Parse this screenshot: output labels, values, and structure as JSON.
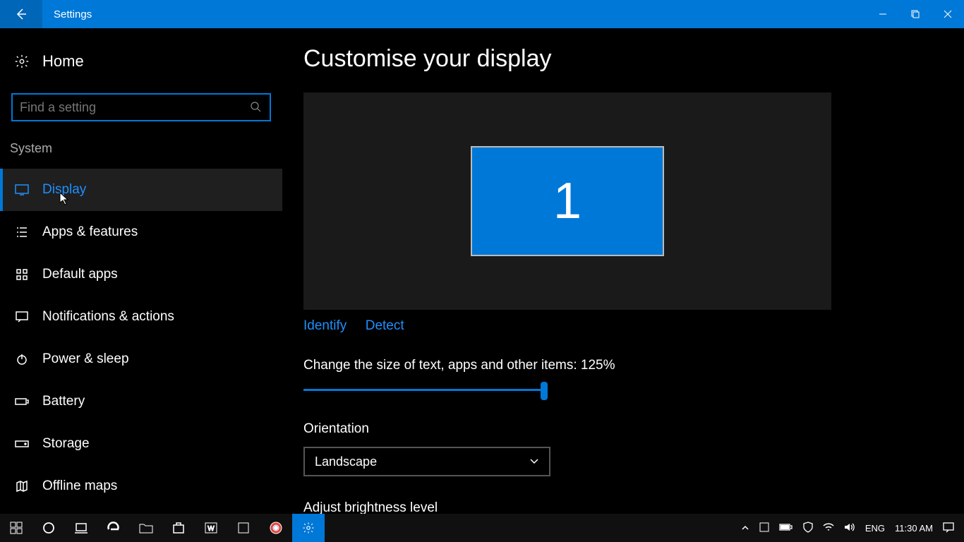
{
  "titlebar": {
    "title": "Settings"
  },
  "sidebar": {
    "home": "Home",
    "search_placeholder": "Find a setting",
    "category": "System",
    "items": [
      {
        "label": "Display"
      },
      {
        "label": "Apps & features"
      },
      {
        "label": "Default apps"
      },
      {
        "label": "Notifications & actions"
      },
      {
        "label": "Power & sleep"
      },
      {
        "label": "Battery"
      },
      {
        "label": "Storage"
      },
      {
        "label": "Offline maps"
      }
    ]
  },
  "main": {
    "title": "Customise your display",
    "monitor_number": "1",
    "identify": "Identify",
    "detect": "Detect",
    "scale_label": "Change the size of text, apps and other items: 125%",
    "orientation_label": "Orientation",
    "orientation_value": "Landscape",
    "brightness_label": "Adjust brightness level"
  },
  "taskbar": {
    "lang": "ENG",
    "time": "11:30 AM"
  }
}
